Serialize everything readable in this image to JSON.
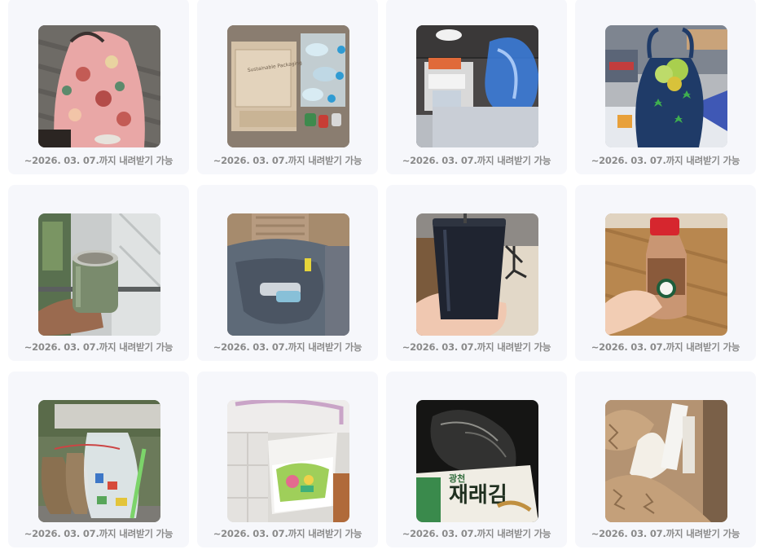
{
  "gallery": {
    "items": [
      {
        "caption": "~2026. 03. 07.까지 내려받기 가능",
        "photo": "floral-tote-bag-photo"
      },
      {
        "caption": "~2026. 03. 07.까지 내려받기 가능",
        "photo": "cardboard-boxes-bottles-photo"
      },
      {
        "caption": "~2026. 03. 07.까지 내려받기 가능",
        "photo": "blue-plastic-bag-entrance-photo"
      },
      {
        "caption": "~2026. 03. 07.까지 내려받기 가능",
        "photo": "star-mesh-bag-vegetables-photo"
      },
      {
        "caption": "~2026. 03. 07.까지 내려받기 가능",
        "photo": "hand-holding-tumbler-photo"
      },
      {
        "caption": "~2026. 03. 07.까지 내려받기 가능",
        "photo": "bag-in-box-recycling-photo"
      },
      {
        "caption": "~2026. 03. 07.까지 내려받기 가능",
        "photo": "black-tumbler-office-photo"
      },
      {
        "caption": "~2026. 03. 07.까지 내려받기 가능",
        "photo": "coffee-bottle-in-hand-photo"
      },
      {
        "caption": "~2026. 03. 07.까지 내려받기 가능",
        "photo": "outdoor-recycling-bags-photo"
      },
      {
        "caption": "~2026. 03. 07.까지 내려받기 가능",
        "photo": "recycling-bin-bags-photo"
      },
      {
        "caption": "~2026. 03. 07.까지 내려받기 가능",
        "photo": "seaweed-package-plastic-photo"
      },
      {
        "caption": "~2026. 03. 07.까지 내려받기 가능",
        "photo": "box-with-paper-packing-photo"
      }
    ],
    "product_text": {
      "box_label": "Sustainable Packaging",
      "seaweed_brand": "재래김",
      "seaweed_small": "광천"
    }
  }
}
